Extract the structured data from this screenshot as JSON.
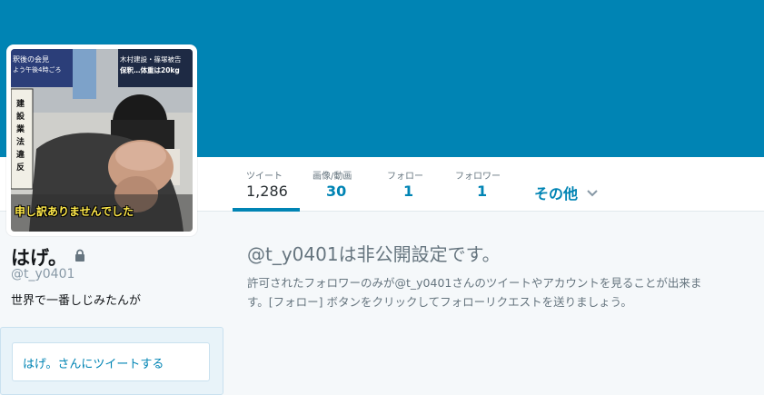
{
  "header": {
    "banner_color": "#0084b4"
  },
  "profile": {
    "name": "はげ。",
    "handle": "@t_y0401",
    "bio": "世界で一番しじみたんが",
    "protected": true,
    "avatar": {
      "caption_top_left_1": "釈後の会見",
      "caption_top_left_2": "よう午後4時ごろ",
      "caption_top_right_1": "木村建設・篠塚被告",
      "caption_top_right_2": "保釈…体重は20kg",
      "caption_vertical": "建設業法違反",
      "subtitle": "申し訳ありませんでした"
    }
  },
  "nav": {
    "stats": [
      {
        "label": "ツイート",
        "value": "1,286"
      },
      {
        "label": "画像/動画",
        "value": "30"
      },
      {
        "label": "フォロー",
        "value": "1"
      },
      {
        "label": "フォロワー",
        "value": "1"
      }
    ],
    "more_label": "その他"
  },
  "tweet_box": {
    "placeholder": "はげ。さんにツイートする"
  },
  "protected_notice": {
    "title": "@t_y0401は非公開設定です。",
    "body": "許可されたフォロワーのみが@t_y0401さんのツイートやアカウントを見ることが出来ます。[フォロー] ボタンをクリックしてフォローリクエストを送りましょう。"
  },
  "colors": {
    "accent": "#0084b4",
    "muted": "#66757f",
    "background": "#f5f8fa"
  }
}
